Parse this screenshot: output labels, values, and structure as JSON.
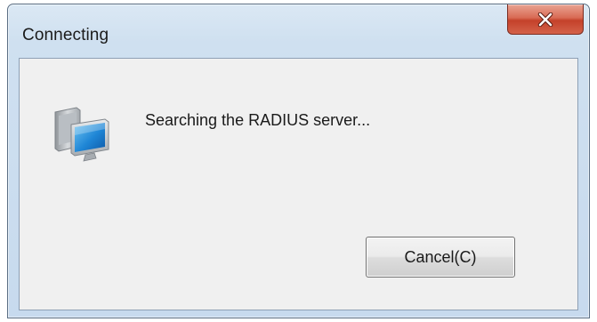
{
  "window": {
    "title": "Connecting",
    "close_icon": "close-x-icon"
  },
  "dialog": {
    "icon": "computer-monitor-icon",
    "message": "Searching the RADIUS server...",
    "cancel_label": "Cancel(C)"
  },
  "colors": {
    "close_button": "#c74a33",
    "frame": "#c7daee",
    "client_background": "#f0f0f0"
  }
}
